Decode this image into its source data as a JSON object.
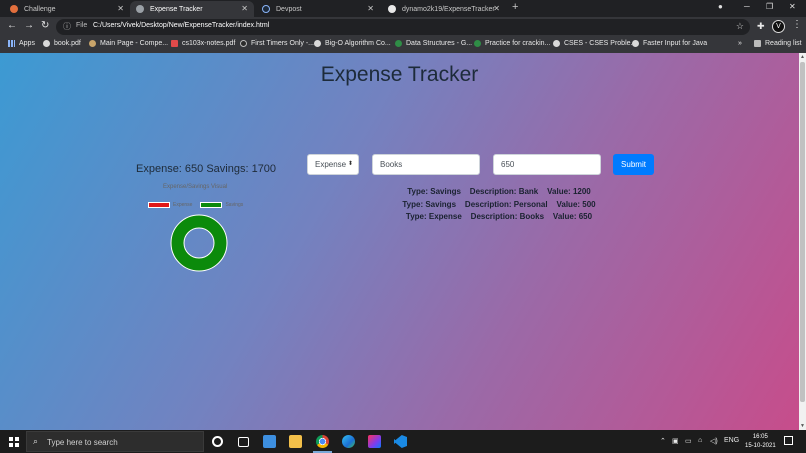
{
  "browser": {
    "tabs": [
      {
        "label": "Challenge",
        "icon": "challenge-favicon",
        "active": false
      },
      {
        "label": "Expense Tracker",
        "icon": "globe-icon",
        "active": true
      },
      {
        "label": "Devpost",
        "icon": "devpost-icon",
        "active": false
      },
      {
        "label": "dynamo2k19/ExpenseTracker",
        "icon": "github-icon",
        "active": false
      }
    ],
    "tab_close_glyph": "✕",
    "new_tab_glyph": "+",
    "address": {
      "scheme_label": "File",
      "url": "C:/Users/Vivek/Desktop/New/ExpenseTracker/index.html"
    },
    "profile_initial": "V",
    "bookmarks": [
      "Apps",
      "book.pdf",
      "Main Page - Compe...",
      "cs103x-notes.pdf",
      "First Timers Only -...",
      "Big-O Algorithm Co...",
      "Data Structures - G...",
      "Practice for crackin...",
      "CSES - CSES Proble...",
      "Faster Input for Java"
    ],
    "overflow_glyph": "»",
    "reading_list": "Reading list"
  },
  "app": {
    "title": "Expense Tracker",
    "summary": "Expense: 650 Savings: 1700",
    "form": {
      "type_selected": "Expense",
      "description_value": "Books",
      "value_value": "650",
      "submit_label": "Submit"
    },
    "entries": [
      "Type: Savings    Description: Bank    Value: 1200",
      "Type: Savings    Description: Personal    Value: 500",
      "Type: Expense    Description: Books    Value: 650"
    ]
  },
  "chart_data": {
    "type": "pie",
    "title": "Expense/Savings Visual",
    "categories": [
      "Expense",
      "Savings"
    ],
    "values": [
      0,
      1
    ],
    "colors": [
      "#e01818",
      "#0b8a0b"
    ],
    "legend_position": "top",
    "donut": true
  },
  "taskbar": {
    "search_placeholder": "Type here to search",
    "language": "ENG",
    "time": "16:05",
    "date": "15-10-2021"
  }
}
